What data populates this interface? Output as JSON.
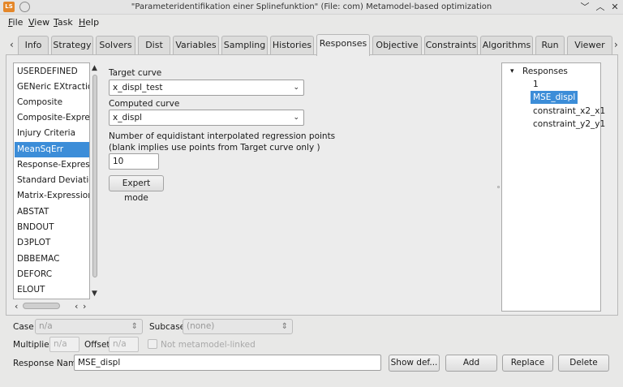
{
  "window": {
    "title": "\"Parameteridentifikation einer Splinefunktion\" (File: com)   Metamodel-based optimization",
    "app_icon_text": "LS",
    "controls": [
      "﹀",
      "︿",
      "✕"
    ]
  },
  "menu": [
    {
      "first": "F",
      "rest": "ile"
    },
    {
      "first": "V",
      "rest": "iew"
    },
    {
      "first": "T",
      "rest": "ask"
    },
    {
      "first": "H",
      "rest": "elp"
    }
  ],
  "tabs": {
    "left_arrow": "‹",
    "right_arrow": "›",
    "items": [
      "Info",
      "Strategy",
      "Solvers",
      "Dist",
      "Variables",
      "Sampling",
      "Histories",
      "Responses",
      "Objective",
      "Constraints",
      "Algorithms",
      "Run",
      "Viewer"
    ],
    "active": "Responses"
  },
  "response_types": {
    "items": [
      "USERDEFINED",
      "GENeric EXtraction",
      "Composite",
      "Composite-Expressi",
      "Injury Criteria",
      "MeanSqErr",
      "Response-Expressio",
      "Standard Deviation",
      "Matrix-Expression",
      "ABSTAT",
      "BNDOUT",
      "D3PLOT",
      "DBBEMAC",
      "DEFORC",
      "ELOUT"
    ],
    "selected": "MeanSqErr",
    "scroll_up": "▲",
    "scroll_down": "▼",
    "scroll_left": "‹",
    "scroll_right": "›"
  },
  "form": {
    "target_curve_label": "Target curve",
    "target_curve_value": "x_displ_test",
    "computed_curve_label": "Computed curve",
    "computed_curve_value": "x_displ",
    "points_label_line1": "Number of equidistant interpolated regression points",
    "points_label_line2": "(blank implies use points from Target curve only )",
    "points_value": "10",
    "expert_button": "Expert mode",
    "combo_arrow": "⌄"
  },
  "tree": {
    "root": "Responses",
    "expand_icon": "▾",
    "items": [
      "1",
      "MSE_displ",
      "constraint_x2_x1",
      "constraint_y2_y1"
    ],
    "selected": "MSE_displ"
  },
  "bottom": {
    "case_label": "Case",
    "case_value": "n/a",
    "subcase_label": "Subcase",
    "subcase_value": "(none)",
    "multiplier_label": "Multiplier",
    "multiplier_value": "n/a",
    "offset_label": "Offset",
    "offset_value": "n/a",
    "not_linked_label": "Not metamodel-linked",
    "response_name_label": "Response Name",
    "response_name_value": "MSE_displ",
    "show_def_button": "Show def...",
    "add_button": "Add",
    "replace_button": "Replace",
    "delete_button": "Delete"
  }
}
